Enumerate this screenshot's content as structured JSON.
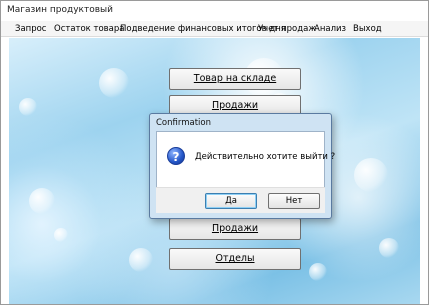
{
  "window": {
    "title": "Магазин продуктовый"
  },
  "menu": {
    "items": [
      "Запрос",
      "Остаток товара",
      "Подведение финансовых итогов дня",
      "Учет продаж",
      "Анализ",
      "Выход"
    ]
  },
  "main_buttons": {
    "stock": "Товар на складе",
    "sales_top": "Продажи",
    "sales_bottom": "Продажи",
    "departments": "Отделы"
  },
  "dialog": {
    "title": "Confirmation",
    "message": "Действительно хотите выйти ?",
    "yes": "Да",
    "no": "Нет",
    "icon": "question-icon"
  }
}
